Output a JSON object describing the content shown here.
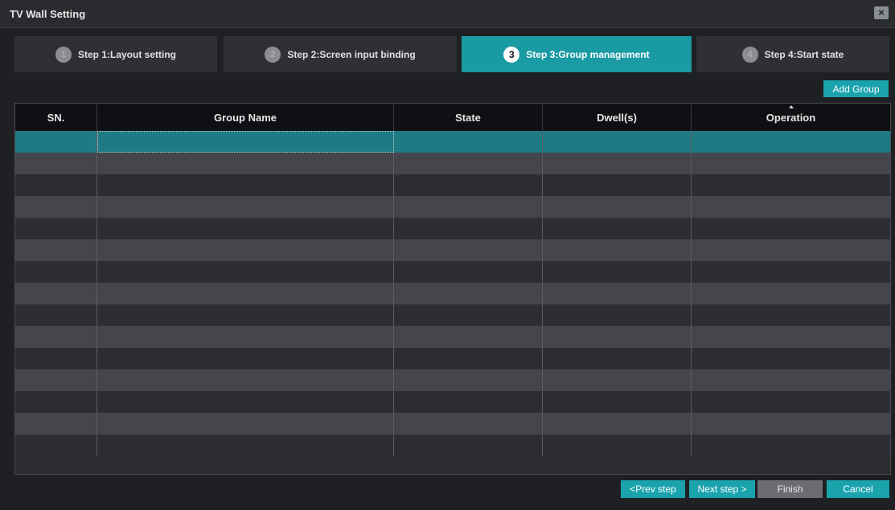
{
  "window": {
    "title": "TV Wall Setting",
    "close_label": "×"
  },
  "steps": [
    {
      "num": "1",
      "label": "Step 1:Layout setting",
      "active": false
    },
    {
      "num": "2",
      "label": "Step 2:Screen input binding",
      "active": false
    },
    {
      "num": "3",
      "label": "Step 3:Group management",
      "active": true
    },
    {
      "num": "4",
      "label": "Step 4:Start state",
      "active": false
    }
  ],
  "toolbar": {
    "add_group_label": "Add Group"
  },
  "table": {
    "columns": [
      "SN.",
      "Group Name",
      "State",
      "Dwell(s)",
      "Operation"
    ],
    "sorted_column": "Operation",
    "row_count": 15,
    "selected_row": 0
  },
  "footer": {
    "prev_label": "<Prev step",
    "next_label": "Next step >",
    "finish_label": "Finish",
    "cancel_label": "Cancel"
  },
  "colors": {
    "accent": "#1aa3ad",
    "selected_row": "#1f7b83",
    "disabled_button": "#6b6d72"
  }
}
